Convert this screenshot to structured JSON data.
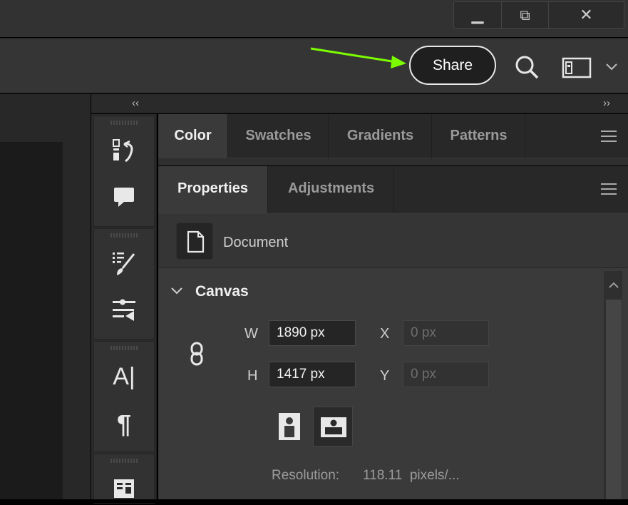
{
  "title_bar": {
    "window_buttons": [
      {
        "name": "minimize",
        "glyph": "▬"
      },
      {
        "name": "restore",
        "glyph": "⧉"
      },
      {
        "name": "close",
        "glyph": "✕"
      }
    ]
  },
  "options_bar": {
    "share_label": "Share",
    "search_icon": "search-icon",
    "workspace_icon": "workspace-icon",
    "workspace_chevron": "chevron-down-icon",
    "annotation_arrow_color": "#7cfc00"
  },
  "collapse_bar": {
    "left_glyph": "‹‹",
    "right_glyph": "››"
  },
  "dock": {
    "groups": [
      {
        "icons": [
          "history-icon",
          "comment-icon"
        ]
      },
      {
        "icons": [
          "brush-settings-icon",
          "tool-presets-icon"
        ]
      },
      {
        "icons": [
          "character-icon",
          "paragraph-icon"
        ]
      },
      {
        "icons": [
          "glyphs-icon"
        ]
      }
    ],
    "glyphs": {
      "character": "A|",
      "paragraph": "¶"
    }
  },
  "color_panel": {
    "tabs": [
      "Color",
      "Swatches",
      "Gradients",
      "Patterns"
    ],
    "active_tab": "Color"
  },
  "properties_panel": {
    "tabs": [
      "Properties",
      "Adjustments"
    ],
    "active_tab": "Properties",
    "document_label": "Document",
    "section_title": "Canvas",
    "fields": {
      "w_label": "W",
      "w_value": "1890 px",
      "h_label": "H",
      "h_value": "1417 px",
      "x_label": "X",
      "x_placeholder": "0 px",
      "y_label": "Y",
      "y_placeholder": "0 px"
    },
    "orientation": [
      "portrait-orientation-icon",
      "landscape-orientation-icon"
    ],
    "resolution_label": "Resolution:",
    "resolution_value": "118.11  pixels/..."
  },
  "colors": {
    "accent_arrow": "#7cfc00",
    "panel_bg": "#3a3a3a",
    "dark_bg": "#282828"
  }
}
